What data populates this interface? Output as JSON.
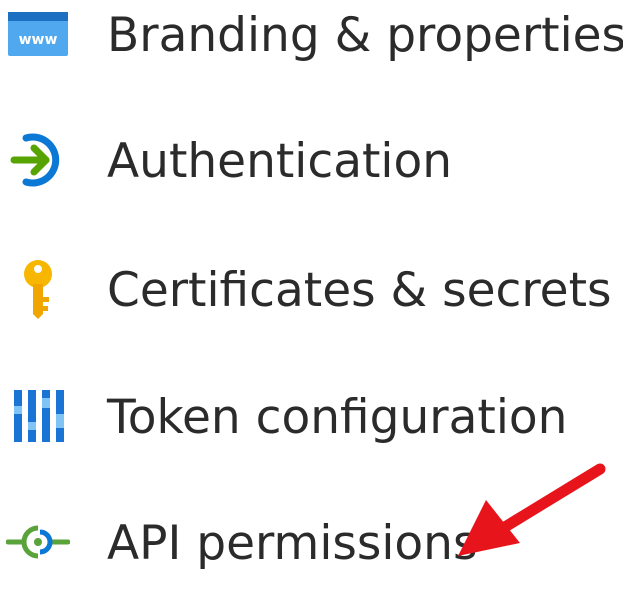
{
  "menu": {
    "items": [
      {
        "label": "Branding & properties",
        "icon": "www-browser-icon"
      },
      {
        "label": "Authentication",
        "icon": "authentication-arrow-icon"
      },
      {
        "label": "Certificates & secrets",
        "icon": "key-icon"
      },
      {
        "label": "Token configuration",
        "icon": "token-bars-icon"
      },
      {
        "label": "API permissions",
        "icon": "api-plug-icon"
      }
    ]
  },
  "annotation": {
    "arrow_color": "#e8141b",
    "points_to": "API permissions"
  },
  "colors": {
    "text": "#2b2b2b",
    "azure_blue": "#0a78d4",
    "green": "#57a300",
    "key_yellow": "#f7b700"
  }
}
